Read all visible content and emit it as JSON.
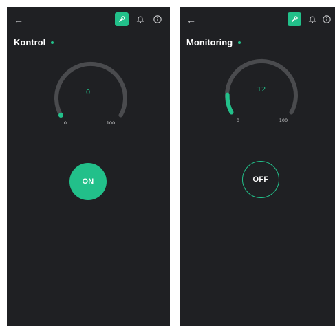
{
  "colors": {
    "accent": "#22c08a",
    "background": "#1f2023",
    "track": "#4a4b4e",
    "text": "#ffffff"
  },
  "icons": {
    "back": "arrow-left-icon",
    "wrench": "wrench-icon",
    "bell": "bell-icon",
    "info": "info-icon"
  },
  "screens": [
    {
      "back_label": "←",
      "title": "Kontrol",
      "gauge": {
        "value": "0",
        "min": "0",
        "max": "100",
        "fill_fraction": 0.0
      },
      "button_label": "ON",
      "button_state": "on"
    },
    {
      "back_label": "←",
      "title": "Monitoring",
      "gauge": {
        "value": "12",
        "min": "0",
        "max": "100",
        "fill_fraction": 0.12
      },
      "button_label": "OFF",
      "button_state": "off"
    }
  ]
}
